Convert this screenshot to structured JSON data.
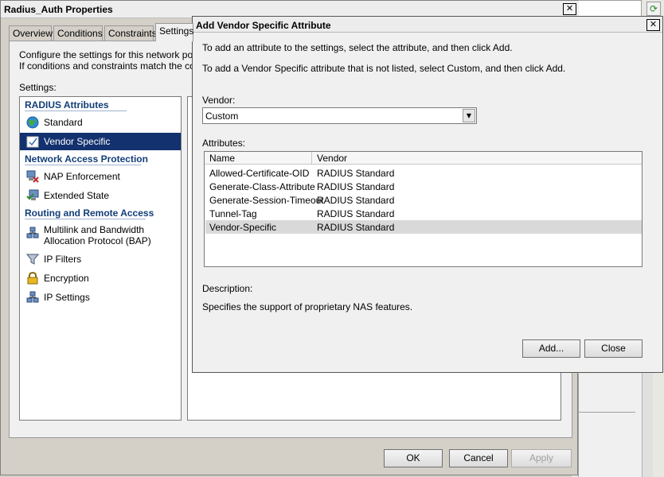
{
  "window": {
    "title": "Radius_Auth Properties",
    "close_glyph": "✕",
    "tabs": [
      {
        "label": "Overview"
      },
      {
        "label": "Conditions"
      },
      {
        "label": "Constraints"
      },
      {
        "label": "Settings"
      }
    ],
    "intro_line1": "Configure the settings for this network policy.",
    "intro_line2": "If conditions and constraints match the connec",
    "settings_label": "Settings:",
    "sections": [
      {
        "title": "RADIUS Attributes",
        "items": [
          {
            "label": "Standard",
            "icon": "globe-icon"
          },
          {
            "label": "Vendor Specific",
            "icon": "check-document-icon",
            "selected": true
          }
        ]
      },
      {
        "title": "Network Access Protection",
        "items": [
          {
            "label": "NAP Enforcement",
            "icon": "nap-enforcement-icon"
          },
          {
            "label": "Extended State",
            "icon": "extended-state-icon"
          }
        ]
      },
      {
        "title": "Routing and Remote Access",
        "items": [
          {
            "label": "Multilink and Bandwidth",
            "label2": "Allocation Protocol (BAP)",
            "icon": "network-icon"
          },
          {
            "label": "IP Filters",
            "icon": "filter-funnel-icon"
          },
          {
            "label": "Encryption",
            "icon": "lock-icon"
          },
          {
            "label": "IP Settings",
            "icon": "network-icon"
          }
        ]
      }
    ],
    "buttons": {
      "ok": "OK",
      "cancel": "Cancel",
      "apply": "Apply"
    }
  },
  "dialog": {
    "title": "Add Vendor Specific Attribute",
    "close_glyph": "✕",
    "instruction1": "To add an attribute to the settings, select the attribute, and then click Add.",
    "instruction2": "To add a Vendor Specific attribute that is not listed, select Custom, and then click Add.",
    "vendor_label": "Vendor:",
    "vendor_value": "Custom",
    "attributes_label": "Attributes:",
    "columns": [
      "Name",
      "Vendor"
    ],
    "rows": [
      {
        "name": "Allowed-Certificate-OID",
        "vendor": "RADIUS Standard"
      },
      {
        "name": "Generate-Class-Attribute",
        "vendor": "RADIUS Standard"
      },
      {
        "name": "Generate-Session-Timeout",
        "vendor": "RADIUS Standard"
      },
      {
        "name": "Tunnel-Tag",
        "vendor": "RADIUS Standard"
      },
      {
        "name": "Vendor-Specific",
        "vendor": "RADIUS Standard",
        "selected": true
      }
    ],
    "description_label": "Description:",
    "description_text": "Specifies the support of proprietary NAS features.",
    "buttons": {
      "add": "Add...",
      "close": "Close"
    }
  },
  "background_app": {
    "refresh_icon": "refresh-icon",
    "refresh_glyph": "⟳"
  }
}
